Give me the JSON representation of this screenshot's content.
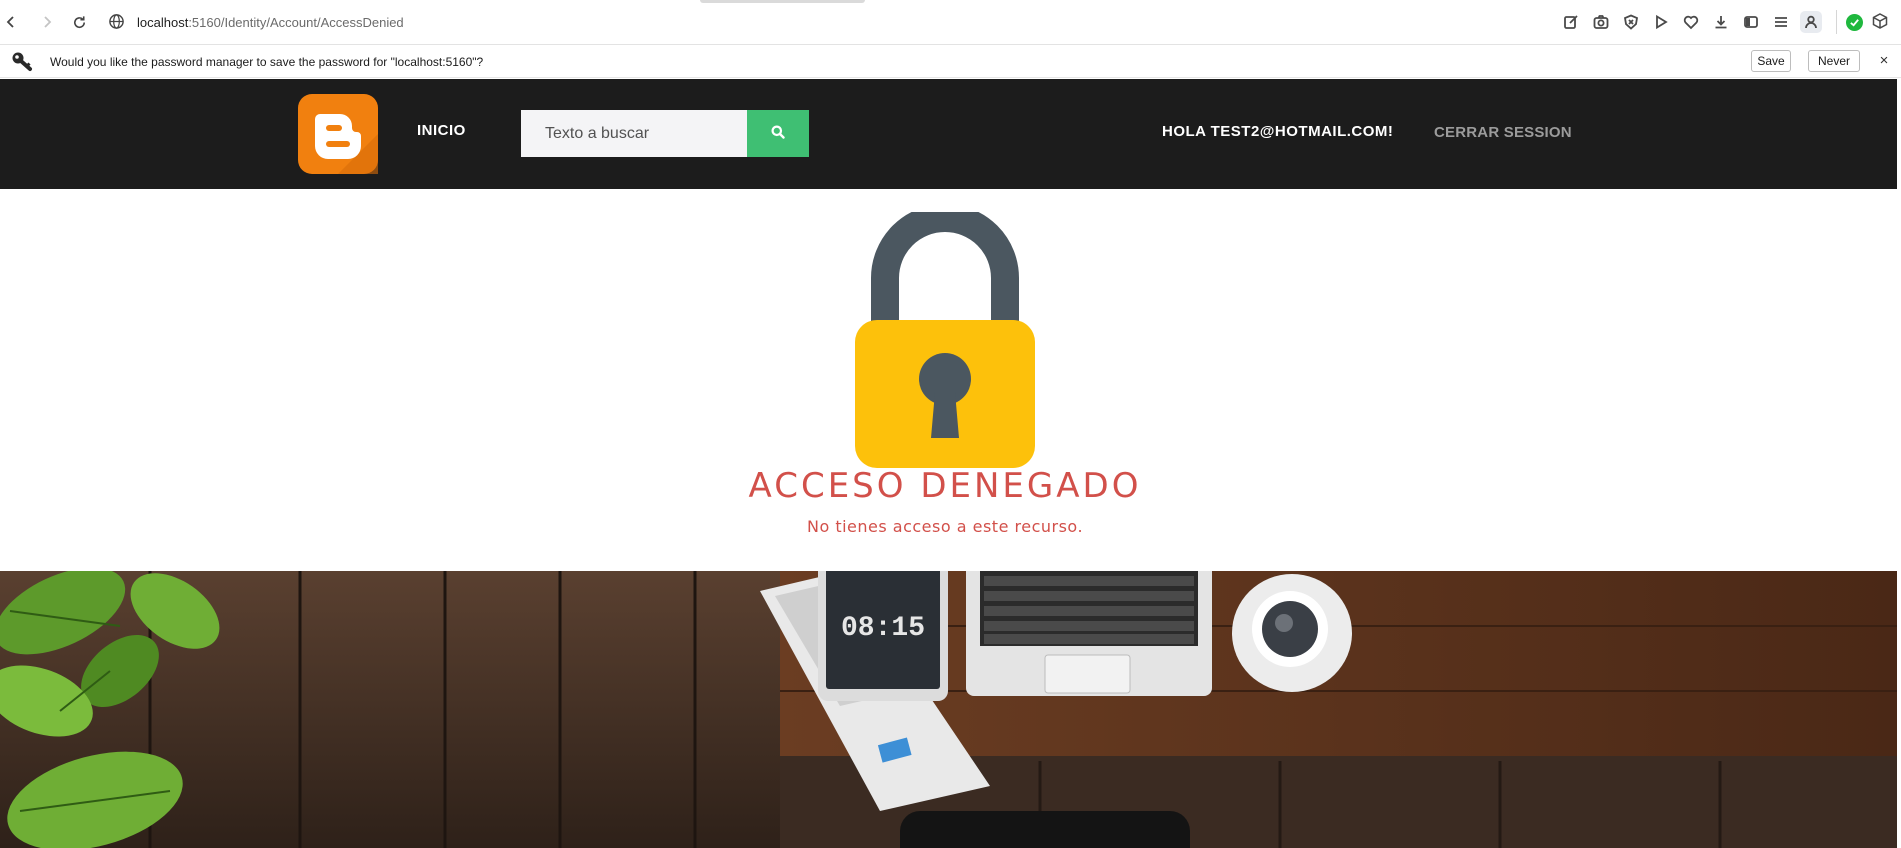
{
  "browser": {
    "url_host": "localhost",
    "url_path": ":5160/Identity/Account/AccessDenied",
    "icons": [
      "back-icon",
      "forward-icon",
      "reload-icon",
      "site-info-icon",
      "edit-icon",
      "camera-icon",
      "shield-icon",
      "play-icon",
      "heart-icon",
      "download-icon",
      "sidebar-icon",
      "menu-icon",
      "profile-icon",
      "extension-check-icon",
      "extension-box-icon"
    ]
  },
  "password_bar": {
    "message": "Would you like the password manager to save the password for \"localhost:5160\"?",
    "save_label": "Save",
    "never_label": "Never",
    "close_label": "×"
  },
  "navbar": {
    "home_label": "INICIO",
    "search_placeholder": "Texto a buscar",
    "greeting": "HOLA TEST2@HOTMAIL.COM!",
    "logout_label": "CERRAR SESSION"
  },
  "content": {
    "title": "ACCESO DENEGADO",
    "subtitle": "No tienes acceso a este recurso."
  },
  "hero": {
    "clock_text": "08:15"
  },
  "colors": {
    "navbar_bg": "#1c1c1c",
    "search_button": "#3fbf73",
    "error_text": "#d2504a",
    "lock_body": "#fdc10b",
    "lock_shackle": "#4b5760",
    "logo_orange": "#f1800f"
  }
}
